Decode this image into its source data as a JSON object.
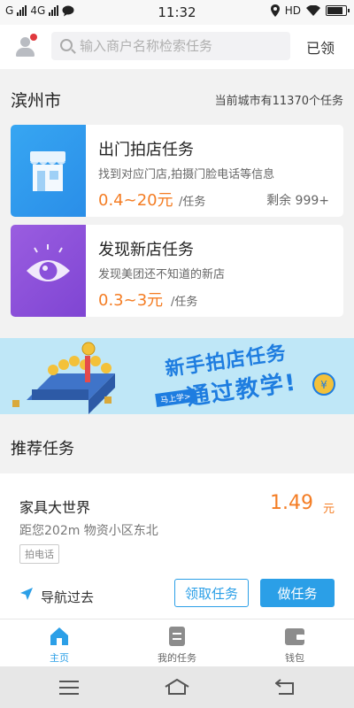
{
  "status_bar": {
    "carrier_left": "G",
    "network": "4G",
    "time": "11:32",
    "hd": "HD"
  },
  "header": {
    "search_placeholder": "输入商户名称检索任务",
    "claimed_label": "已领"
  },
  "city": {
    "name": "滨州市",
    "count_text": "当前城市有11370个任务"
  },
  "tasks": [
    {
      "title": "出门拍店任务",
      "desc": "找到对应门店,拍摄门脸电话等信息",
      "price": "0.4~20元",
      "unit": "/任务",
      "remain": "剩余 999+",
      "icon": "storefront-icon",
      "color": "#37a6f2"
    },
    {
      "title": "发现新店任务",
      "desc": "发现美团还不知道的新店",
      "price": "0.3~3元",
      "unit": "/任务",
      "icon": "eye-icon",
      "color": "#8a50da"
    }
  ],
  "banner": {
    "line1": "新手拍店任务",
    "line2": "通过教学!",
    "cta": "马上学>"
  },
  "recommend": {
    "section_title": "推荐任务",
    "item": {
      "name": "家具大世界",
      "price": "1.49",
      "currency": "元",
      "meta": "距您202m  物资小区东北",
      "tag": "拍电话",
      "navigate_label": "导航过去",
      "claim_button": "领取任务",
      "do_button": "做任务"
    }
  },
  "tabbar": {
    "items": [
      {
        "label": "主页",
        "icon": "home-icon",
        "active": true
      },
      {
        "label": "我的任务",
        "icon": "task-list-icon",
        "active": false
      },
      {
        "label": "钱包",
        "icon": "wallet-icon",
        "active": false
      }
    ]
  },
  "colors": {
    "accent": "#2b9fe7",
    "price": "#f47d24"
  }
}
